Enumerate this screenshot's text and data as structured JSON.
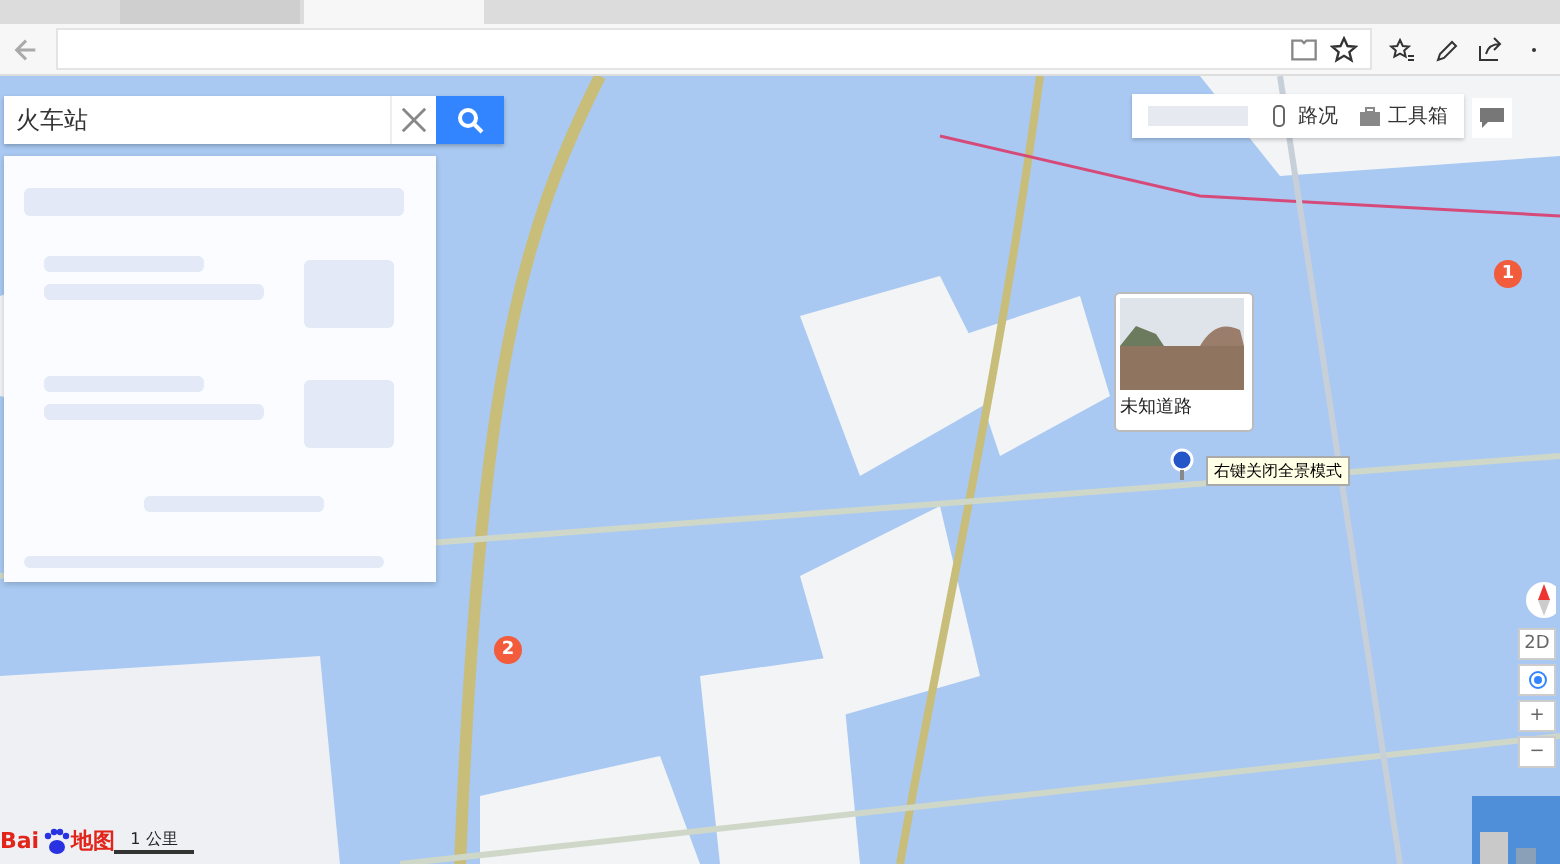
{
  "browser": {
    "tabs": [
      {
        "selected": false
      },
      {
        "selected": true
      }
    ]
  },
  "search": {
    "value": "火车站"
  },
  "map_toolbar": {
    "items": [
      {
        "label": "路况"
      },
      {
        "label": "工具箱"
      }
    ]
  },
  "popup": {
    "title": "未知道路"
  },
  "tooltip": "右键关闭全景模式",
  "markers": [
    {
      "number": "1"
    },
    {
      "number": "2"
    }
  ],
  "logo": {
    "left": "Bai",
    "right": "地图"
  },
  "scale": "1 公里",
  "view_controls": {
    "mode": "2D",
    "zoom_in": "+",
    "zoom_out": "−"
  }
}
